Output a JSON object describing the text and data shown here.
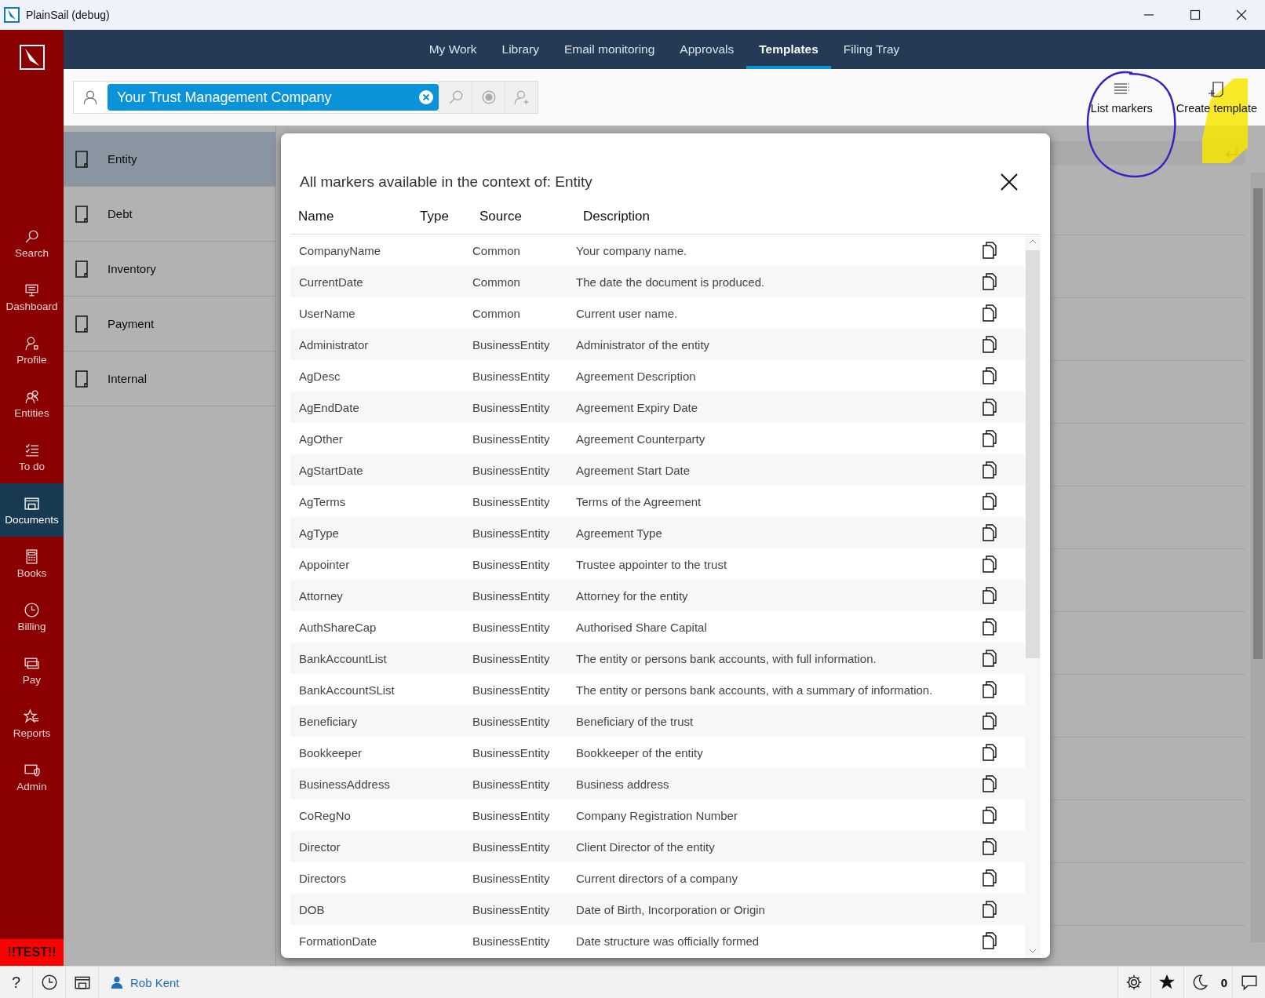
{
  "window": {
    "title": "PlainSail (debug)"
  },
  "nav_tabs": [
    {
      "label": "My Work",
      "selected": false
    },
    {
      "label": "Library",
      "selected": false
    },
    {
      "label": "Email monitoring",
      "selected": false
    },
    {
      "label": "Approvals",
      "selected": false
    },
    {
      "label": "Templates",
      "selected": true
    },
    {
      "label": "Filing Tray",
      "selected": false
    }
  ],
  "sidebar": {
    "items": [
      {
        "label": "Search",
        "selected": false
      },
      {
        "label": "Dashboard",
        "selected": false
      },
      {
        "label": "Profile",
        "selected": false
      },
      {
        "label": "Entities",
        "selected": false
      },
      {
        "label": "To do",
        "selected": false
      },
      {
        "label": "Documents",
        "selected": true
      },
      {
        "label": "Books",
        "selected": false
      },
      {
        "label": "Billing",
        "selected": false
      },
      {
        "label": "Pay",
        "selected": false
      },
      {
        "label": "Reports",
        "selected": false
      },
      {
        "label": "Admin",
        "selected": false
      }
    ],
    "badge": "!!TEST!!"
  },
  "entity_search": {
    "value": "Your Trust Management Company"
  },
  "toolbar_actions": [
    {
      "label": "List markers"
    },
    {
      "label": "Create template"
    }
  ],
  "template_categories": [
    {
      "label": "Entity",
      "selected": true
    },
    {
      "label": "Debt",
      "selected": false
    },
    {
      "label": "Inventory",
      "selected": false
    },
    {
      "label": "Payment",
      "selected": false
    },
    {
      "label": "Internal",
      "selected": false
    }
  ],
  "markers_dialog": {
    "title": "All markers available in the context of: Entity",
    "columns": [
      "Name",
      "Type",
      "Source",
      "Description"
    ],
    "rows": [
      {
        "name": "CompanyName",
        "source": "Common",
        "description": "Your company name."
      },
      {
        "name": "CurrentDate",
        "source": "Common",
        "description": "The date the document is produced."
      },
      {
        "name": "UserName",
        "source": "Common",
        "description": "Current user name."
      },
      {
        "name": "Administrator",
        "source": "BusinessEntity",
        "description": "Administrator of the entity"
      },
      {
        "name": "AgDesc",
        "source": "BusinessEntity",
        "description": "Agreement Description"
      },
      {
        "name": "AgEndDate",
        "source": "BusinessEntity",
        "description": "Agreement Expiry Date"
      },
      {
        "name": "AgOther",
        "source": "BusinessEntity",
        "description": "Agreement Counterparty"
      },
      {
        "name": "AgStartDate",
        "source": "BusinessEntity",
        "description": "Agreement Start Date"
      },
      {
        "name": "AgTerms",
        "source": "BusinessEntity",
        "description": "Terms of the Agreement"
      },
      {
        "name": "AgType",
        "source": "BusinessEntity",
        "description": "Agreement Type"
      },
      {
        "name": "Appointer",
        "source": "BusinessEntity",
        "description": "Trustee appointer to the trust"
      },
      {
        "name": "Attorney",
        "source": "BusinessEntity",
        "description": "Attorney for the entity"
      },
      {
        "name": "AuthShareCap",
        "source": "BusinessEntity",
        "description": "Authorised Share Capital"
      },
      {
        "name": "BankAccountList",
        "source": "BusinessEntity",
        "description": "The entity or persons bank accounts, with full information."
      },
      {
        "name": "BankAccountSList",
        "source": "BusinessEntity",
        "description": "The entity or persons bank accounts, with a summary of information."
      },
      {
        "name": "Beneficiary",
        "source": "BusinessEntity",
        "description": "Beneficiary of the trust"
      },
      {
        "name": "Bookkeeper",
        "source": "BusinessEntity",
        "description": "Bookkeeper of the entity"
      },
      {
        "name": "BusinessAddress",
        "source": "BusinessEntity",
        "description": "Business address"
      },
      {
        "name": "CoRegNo",
        "source": "BusinessEntity",
        "description": "Company Registration Number"
      },
      {
        "name": "Director",
        "source": "BusinessEntity",
        "description": "Client Director of the entity"
      },
      {
        "name": "Directors",
        "source": "BusinessEntity",
        "description": "Current directors of a company"
      },
      {
        "name": "DOB",
        "source": "BusinessEntity",
        "description": "Date of Birth, Incorporation or Origin"
      },
      {
        "name": "FormationDate",
        "source": "BusinessEntity",
        "description": "Date structure was officially formed"
      }
    ]
  },
  "status_bar": {
    "user": "Rob Kent",
    "help": "?",
    "count": "0"
  }
}
